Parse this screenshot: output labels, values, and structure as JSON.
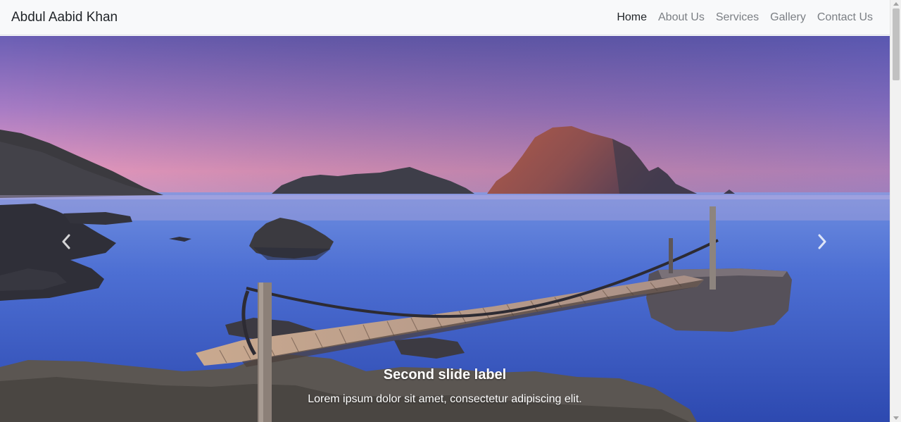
{
  "navbar": {
    "brand": "Abdul Aabid Khan",
    "links": [
      {
        "label": "Home",
        "active": true
      },
      {
        "label": "About Us",
        "active": false
      },
      {
        "label": "Services",
        "active": false
      },
      {
        "label": "Gallery",
        "active": false
      },
      {
        "label": "Contact Us",
        "active": false
      }
    ]
  },
  "carousel": {
    "caption_title": "Second slide label",
    "caption_text": "Lorem ipsum dolor sit amet, consectetur adipiscing elit.",
    "controls": {
      "prev_icon": "chevron-left-icon",
      "next_icon": "chevron-right-icon"
    }
  },
  "colors": {
    "navbar_bg": "#f8f9fa",
    "nav_active": "#212529",
    "nav_inactive": "#7b7f84",
    "sky_top": "#6b5fb5",
    "sky_horizon": "#e79ac0",
    "sea": "#3f63c8"
  }
}
